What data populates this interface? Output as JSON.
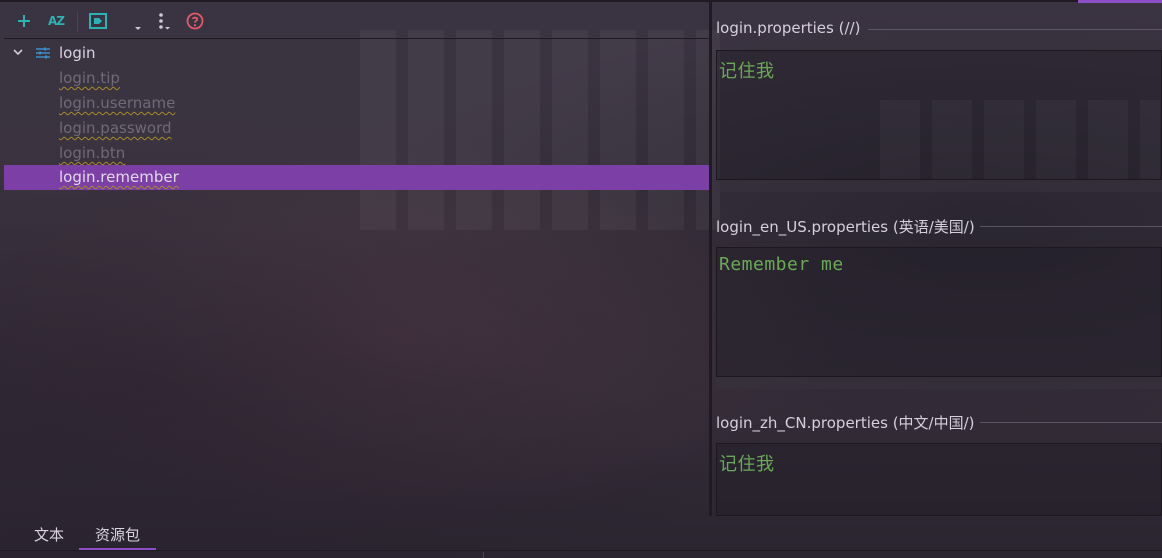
{
  "toolbar": {
    "icons": [
      "add-icon",
      "sort-az-icon",
      "tag-icon",
      "dropdown-icon",
      "more-icon",
      "help-icon"
    ],
    "sort_text": "AZ"
  },
  "tree": {
    "root": "login",
    "items": [
      {
        "label": "login.tip",
        "selected": false
      },
      {
        "label": "login.username",
        "selected": false
      },
      {
        "label": "login.password",
        "selected": false
      },
      {
        "label": "login.btn",
        "selected": false
      },
      {
        "label": "login.remember",
        "selected": true
      }
    ]
  },
  "sections": [
    {
      "title": "login.properties (//)",
      "value": "记住我"
    },
    {
      "title": "login_en_US.properties (英语/美国/)",
      "value": "Remember me"
    },
    {
      "title": "login_zh_CN.properties (中文/中国/)",
      "value": "记住我"
    }
  ],
  "tabs": [
    {
      "label": "文本",
      "active": false
    },
    {
      "label": "资源包",
      "active": true
    }
  ],
  "colors": {
    "accent": "#8e4ec6",
    "selection": "#7c3fa6",
    "value_text": "#6aaa56",
    "add_icon": "#2bb3b3",
    "help_icon": "#e05a6a"
  }
}
